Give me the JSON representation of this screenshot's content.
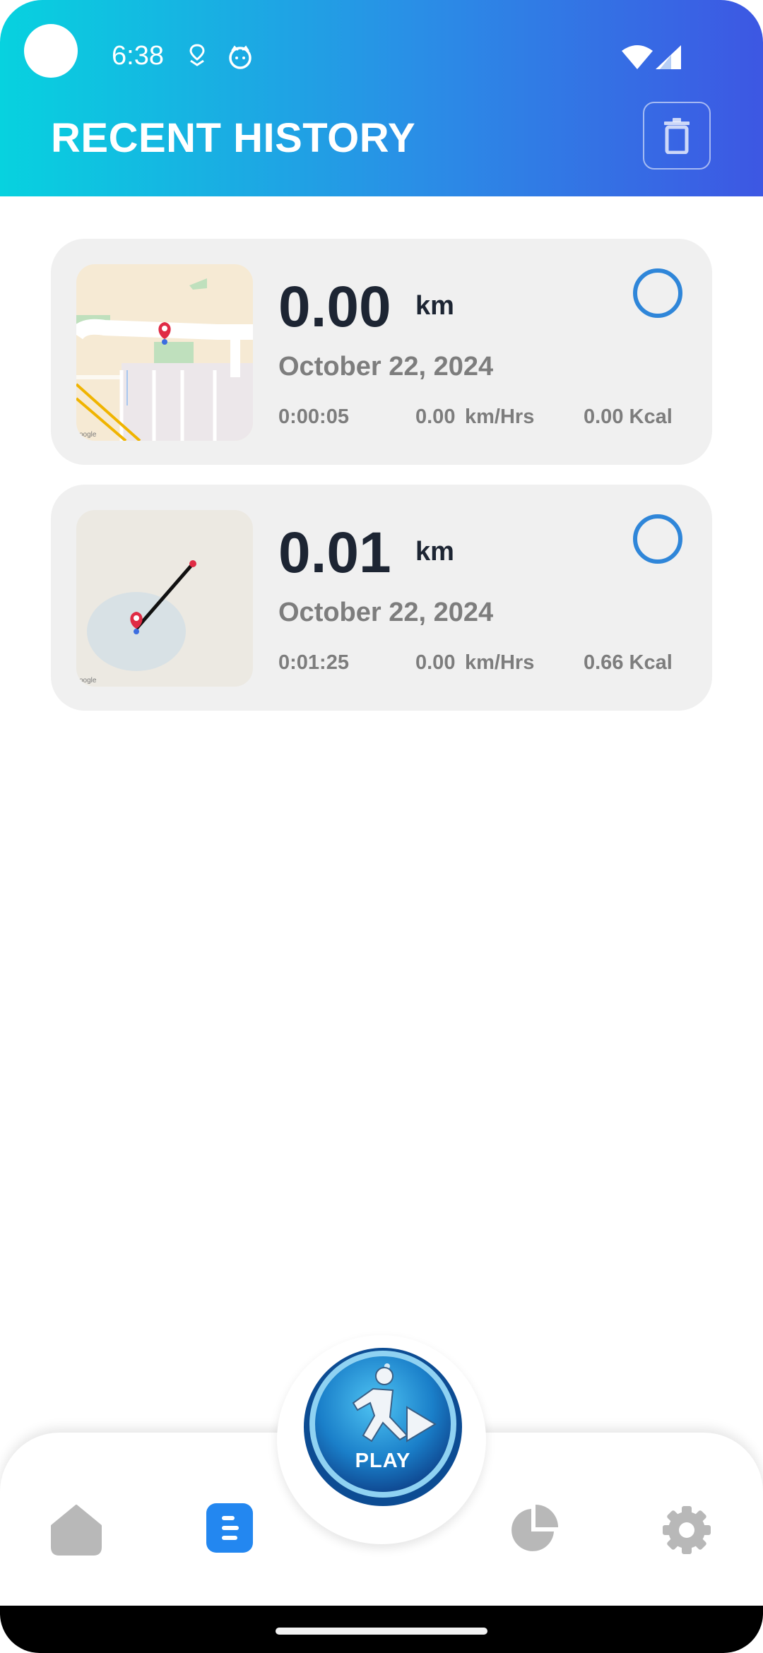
{
  "status_bar": {
    "time": "6:38",
    "icons": [
      "location-icon",
      "cat-face-icon",
      "wifi-icon",
      "signal-icon"
    ]
  },
  "header": {
    "title": "RECENT HISTORY",
    "delete_icon": "trash-icon"
  },
  "history": [
    {
      "distance": "0.00",
      "unit": "km",
      "date": "October 22, 2024",
      "duration": "0:00:05",
      "speed": "0.00",
      "speed_unit": "km/Hrs",
      "calories": "0.00 Kcal",
      "selected": false,
      "map_label": "oogle"
    },
    {
      "distance": "0.01",
      "unit": "km",
      "date": "October 22, 2024",
      "duration": "0:01:25",
      "speed": "0.00",
      "speed_unit": "km/Hrs",
      "calories": "0.66 Kcal",
      "selected": false,
      "map_label": "oogle"
    }
  ],
  "nav": {
    "items": [
      {
        "name": "home",
        "icon": "home-icon",
        "active": false
      },
      {
        "name": "history",
        "icon": "list-icon",
        "active": true
      },
      {
        "name": "stats",
        "icon": "pie-chart-icon",
        "active": false
      },
      {
        "name": "settings",
        "icon": "gear-icon",
        "active": false
      }
    ],
    "play_label": "PLAY"
  },
  "colors": {
    "header_start": "#07d2df",
    "header_end": "#3d57e3",
    "accent": "#2f86d9",
    "active_nav": "#2387f0",
    "inactive_nav": "#b8b8b8"
  }
}
